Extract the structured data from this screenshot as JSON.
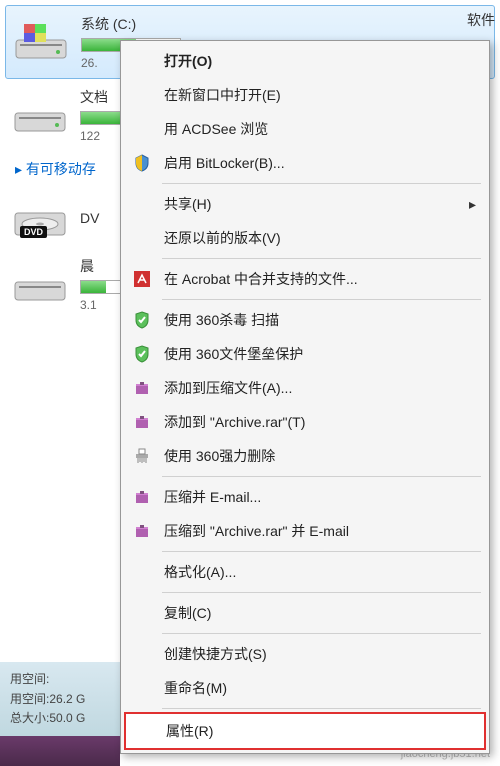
{
  "drives": {
    "c": {
      "label": "系统 (C:)",
      "size": "26."
    },
    "software": {
      "label": "软件"
    },
    "docs": {
      "label": "文档",
      "size": "122"
    },
    "dvd": {
      "label": "DV"
    },
    "other": {
      "label": "晨",
      "size": "3.1"
    }
  },
  "section_removable": "有可移动存",
  "menu": {
    "open": "打开(O)",
    "open_new_window": "在新窗口中打开(E)",
    "acdsee": "用 ACDSee 浏览",
    "bitlocker": "启用 BitLocker(B)...",
    "share": "共享(H)",
    "restore_version": "还原以前的版本(V)",
    "acrobat": "在 Acrobat 中合并支持的文件...",
    "scan360": "使用 360杀毒 扫描",
    "protect360": "使用 360文件堡垒保护",
    "add_archive": "添加到压缩文件(A)...",
    "add_archive_rar": "添加到 \"Archive.rar\"(T)",
    "force_delete": "使用 360强力删除",
    "compress_email": "压缩并 E-mail...",
    "compress_rar_email": "压缩到 \"Archive.rar\" 并 E-mail",
    "format": "格式化(A)...",
    "copy": "复制(C)",
    "create_shortcut": "创建快捷方式(S)",
    "rename": "重命名(M)",
    "properties": "属性(R)"
  },
  "bottom": {
    "used_label": "用空间:",
    "used_value": " 26.2 G",
    "total_label": "总大小:",
    "total_value": " 50.0 G"
  },
  "watermark": {
    "line1": "jiaocheng.jb51.net"
  }
}
